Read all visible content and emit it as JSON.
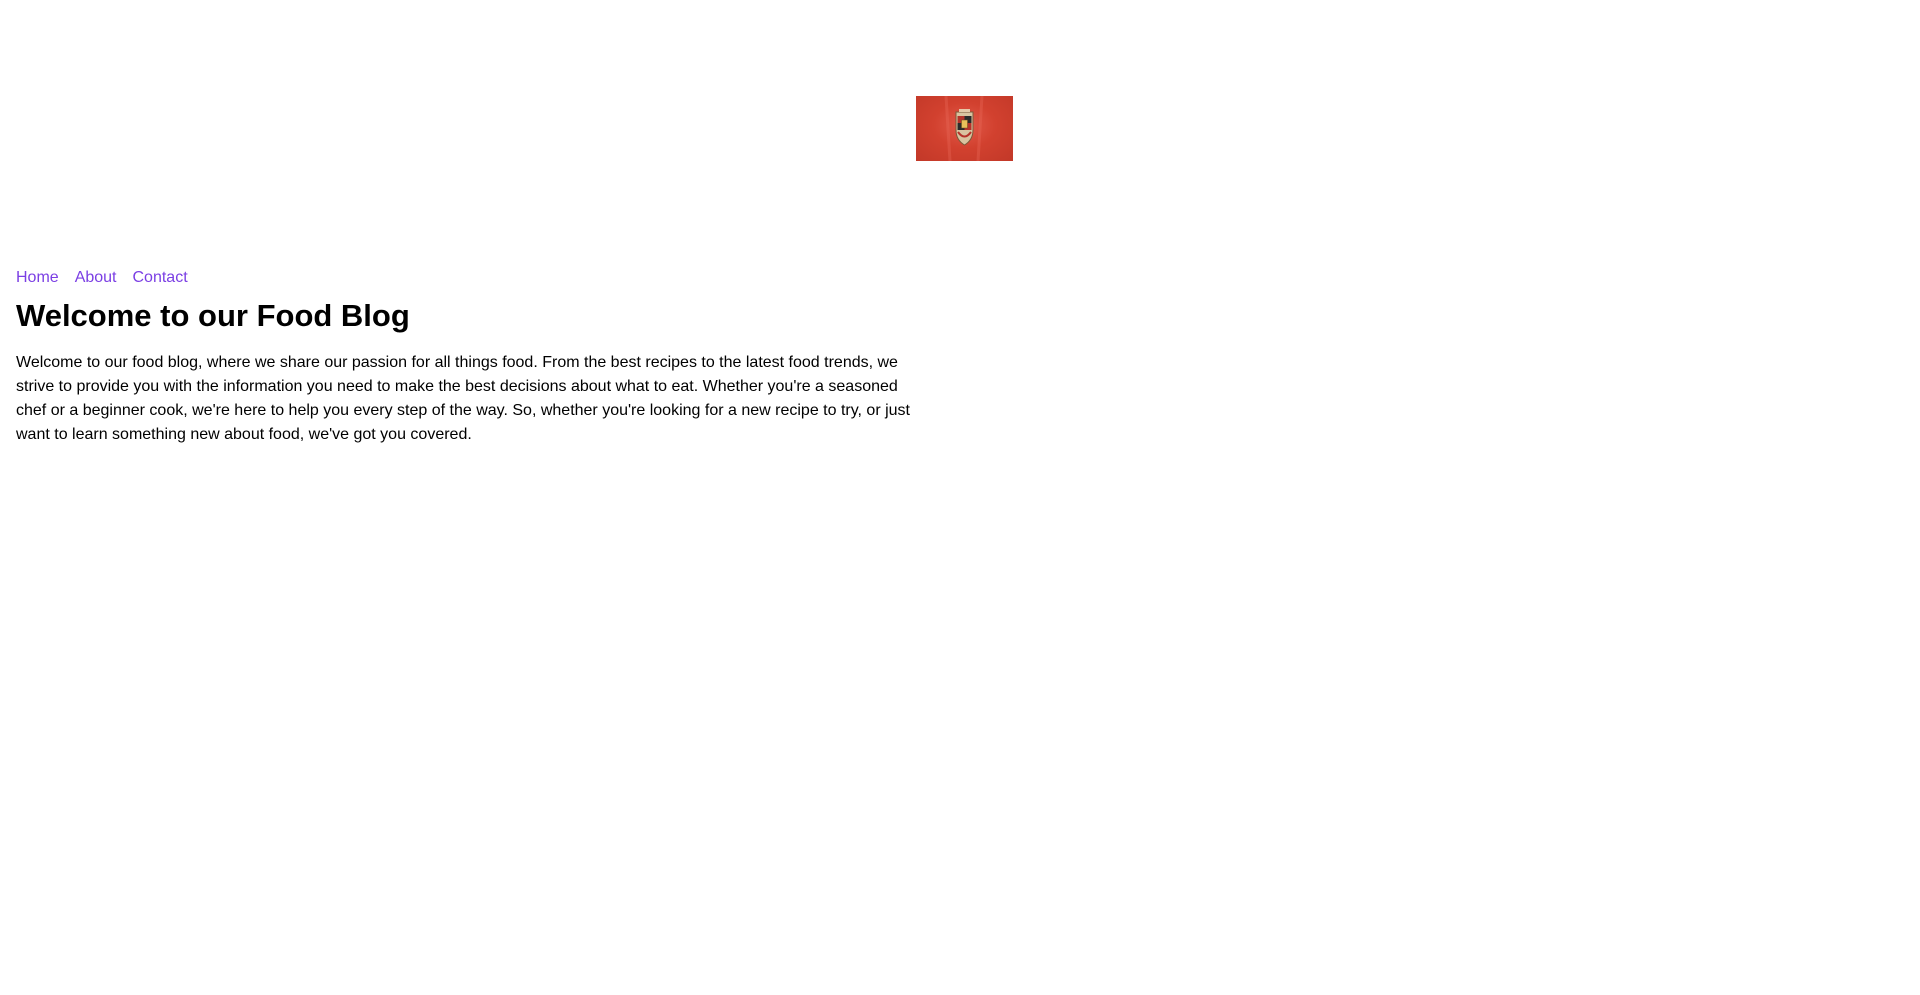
{
  "hero": {
    "logo_icon": "porsche-crest-icon",
    "background_color": "#d2412f"
  },
  "nav": {
    "link_color": "#7b3fe4",
    "items": [
      {
        "label": "Home"
      },
      {
        "label": "About"
      },
      {
        "label": "Contact"
      }
    ]
  },
  "main": {
    "title": "Welcome to our Food Blog",
    "intro": "Welcome to our food blog, where we share our passion for all things food. From the best recipes to the latest food trends, we strive to provide you with the information you need to make the best decisions about what to eat. Whether you're a seasoned chef or a beginner cook, we're here to help you every step of the way. So, whether you're looking for a new recipe to try, or just want to learn something new about food, we've got you covered."
  }
}
